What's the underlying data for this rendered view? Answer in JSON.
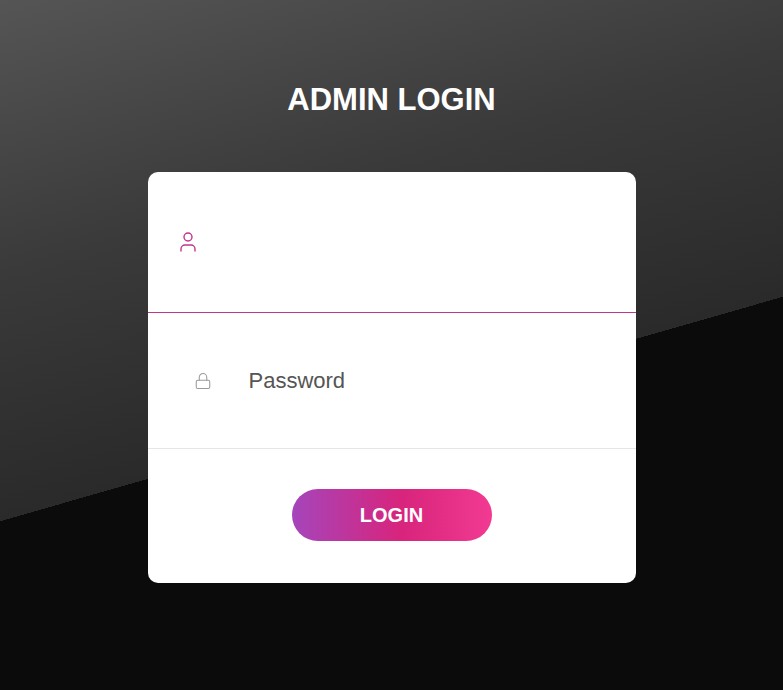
{
  "page": {
    "title": "ADMIN LOGIN"
  },
  "form": {
    "username": {
      "placeholder": "",
      "focused": true
    },
    "password": {
      "placeholder": "Password",
      "focused": false
    }
  },
  "buttons": [
    "LOGIN"
  ]
}
